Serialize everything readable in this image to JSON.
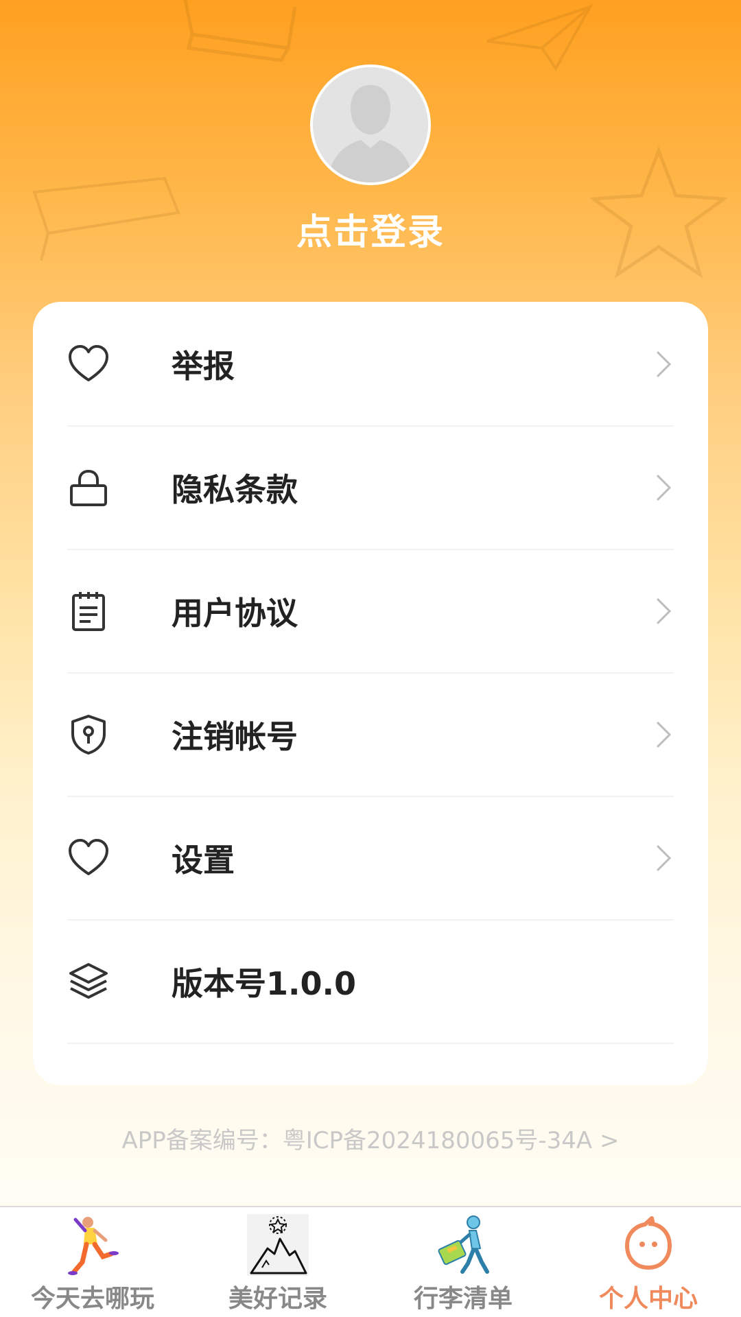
{
  "profile": {
    "login_label": "点击登录"
  },
  "menu": {
    "items": [
      {
        "label": "举报",
        "icon": "heart-icon",
        "has_chevron": true
      },
      {
        "label": "隐私条款",
        "icon": "lock-icon",
        "has_chevron": true
      },
      {
        "label": "用户协议",
        "icon": "notepad-icon",
        "has_chevron": true
      },
      {
        "label": "注销帐号",
        "icon": "shield-keyhole-icon",
        "has_chevron": true
      },
      {
        "label": "设置",
        "icon": "heart-icon",
        "has_chevron": true
      },
      {
        "label": "版本号1.0.0",
        "icon": "layers-icon",
        "has_chevron": false
      }
    ]
  },
  "footer": {
    "icp_text": "APP备案编号：粤ICP备2024180065号-34A >"
  },
  "tabbar": {
    "tabs": [
      {
        "label": "今天去哪玩",
        "icon": "jumping-person-icon",
        "active": false
      },
      {
        "label": "美好记录",
        "icon": "mountain-star-icon",
        "active": false
      },
      {
        "label": "行李清单",
        "icon": "walking-suitcase-icon",
        "active": false
      },
      {
        "label": "个人中心",
        "icon": "smiley-face-icon",
        "active": true
      }
    ]
  },
  "colors": {
    "header_top": "#FFA020",
    "active_tab": "#F08A5D",
    "inactive_tab": "#888888",
    "card_bg": "#FFFFFF"
  }
}
